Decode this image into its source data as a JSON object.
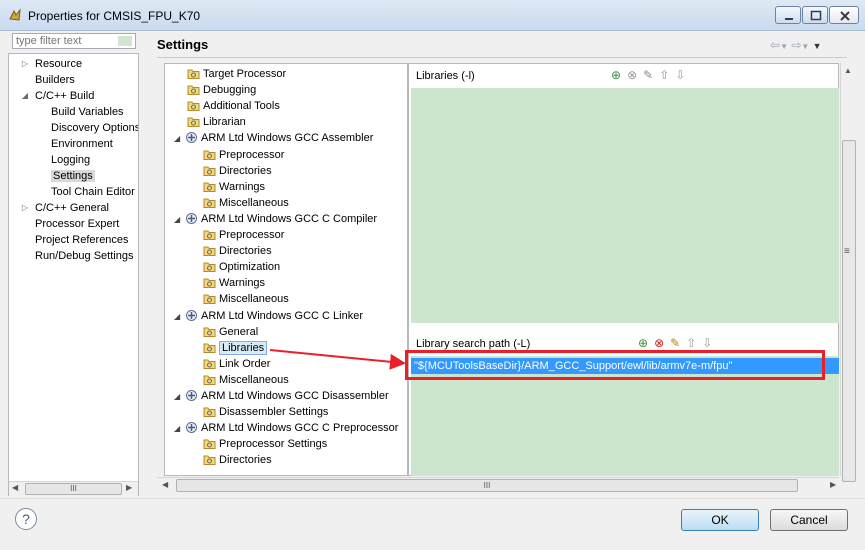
{
  "window": {
    "title": "Properties for CMSIS_FPU_K70",
    "controls": [
      "minimize-icon",
      "maximize-icon",
      "close-icon"
    ]
  },
  "filter": {
    "placeholder": "type filter text"
  },
  "nav": {
    "items": [
      {
        "label": "Resource",
        "arrow": "▷"
      },
      {
        "label": "Builders",
        "arrow": ""
      },
      {
        "label": "C/C++ Build",
        "arrow": "◢"
      },
      {
        "label": "Build Variables",
        "arrow": ""
      },
      {
        "label": "Discovery Options",
        "arrow": ""
      },
      {
        "label": "Environment",
        "arrow": ""
      },
      {
        "label": "Logging",
        "arrow": ""
      },
      {
        "label": "Settings",
        "arrow": "",
        "selected": true
      },
      {
        "label": "Tool Chain Editor",
        "arrow": ""
      },
      {
        "label": "C/C++ General",
        "arrow": "▷"
      },
      {
        "label": "Processor Expert",
        "arrow": ""
      },
      {
        "label": "Project References",
        "arrow": ""
      },
      {
        "label": "Run/Debug Settings",
        "arrow": ""
      }
    ],
    "scroll_label": "III"
  },
  "header": {
    "title": "Settings"
  },
  "tree": {
    "items": [
      {
        "label": "Target Processor"
      },
      {
        "label": "Debugging"
      },
      {
        "label": "Additional Tools"
      },
      {
        "label": "Librarian"
      },
      {
        "label": "ARM Ltd Windows GCC Assembler",
        "tool": true
      },
      {
        "label": "Preprocessor"
      },
      {
        "label": "Directories"
      },
      {
        "label": "Warnings"
      },
      {
        "label": "Miscellaneous"
      },
      {
        "label": "ARM Ltd Windows GCC C Compiler",
        "tool": true
      },
      {
        "label": "Preprocessor"
      },
      {
        "label": "Directories"
      },
      {
        "label": "Optimization"
      },
      {
        "label": "Warnings"
      },
      {
        "label": "Miscellaneous"
      },
      {
        "label": "ARM Ltd Windows GCC C Linker",
        "tool": true
      },
      {
        "label": "General"
      },
      {
        "label": "Libraries",
        "selected": true
      },
      {
        "label": "Link Order"
      },
      {
        "label": "Miscellaneous"
      },
      {
        "label": "ARM Ltd Windows GCC Disassembler",
        "tool": true
      },
      {
        "label": "Disassembler Settings"
      },
      {
        "label": "ARM Ltd Windows GCC C Preprocessor",
        "tool": true
      },
      {
        "label": "Preprocessor Settings"
      },
      {
        "label": "Directories"
      }
    ]
  },
  "libraries_pane": {
    "title": "Libraries (-l)"
  },
  "search_path_pane": {
    "title": "Library search path (-L)",
    "entries": [
      "\"${MCUToolsBaseDir}/ARM_GCC_Support/ewl/lib/armv7e-m/fpu\""
    ]
  },
  "scrollbars": {
    "h_label": "III",
    "v_label": "≡"
  },
  "buttons": {
    "ok": "OK",
    "cancel": "Cancel",
    "help": "?"
  },
  "colors": {
    "list_bg": "#cbe6cd",
    "selection": "#3399ff",
    "annotation": "#e8202a"
  }
}
